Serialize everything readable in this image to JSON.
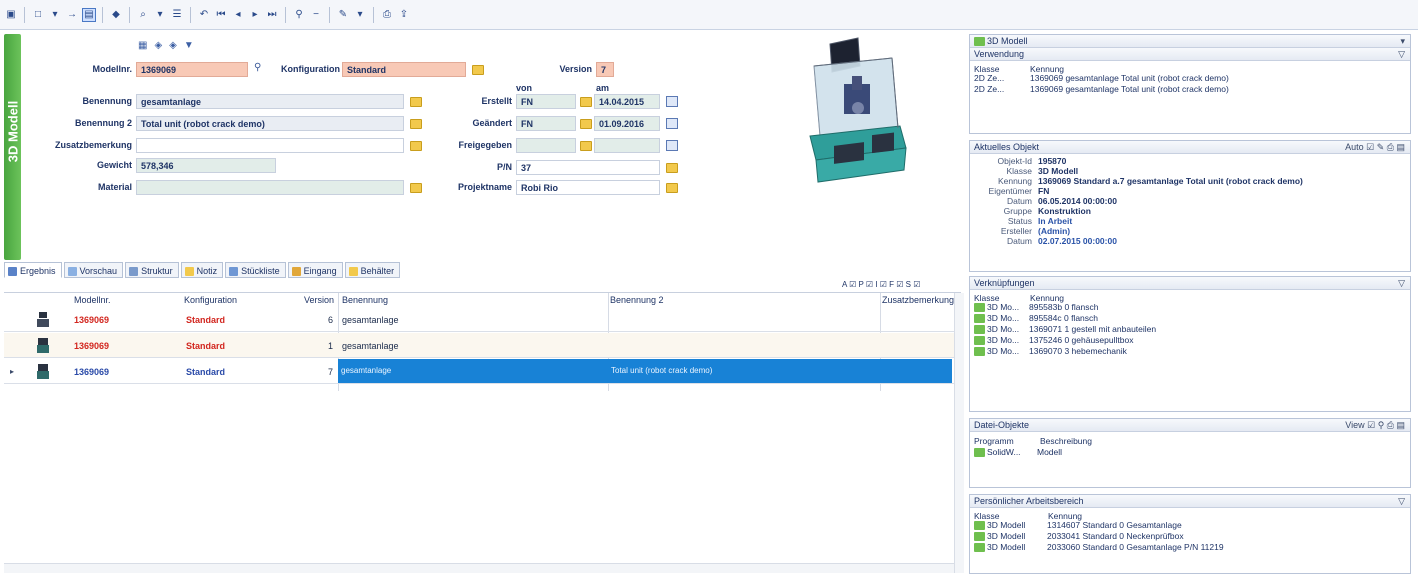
{
  "form": {
    "modellnr_label": "Modellnr.",
    "modellnr_value": "1369069",
    "konfiguration_label": "Konfiguration",
    "konfiguration_value": "Standard",
    "version_label": "Version",
    "version_value": "7",
    "von_label": "von",
    "am_label": "am",
    "benennung_label": "Benennung",
    "benennung_value": "gesamtanlage",
    "benennung2_label": "Benennung 2",
    "benennung2_value": "Total unit (robot crack demo)",
    "zusatz_label": "Zusatzbemerkung",
    "gewicht_label": "Gewicht",
    "gewicht_value": "578,346",
    "material_label": "Material",
    "erstellt_label": "Erstellt",
    "erstellt_von": "FN",
    "erstellt_am": "14.04.2015",
    "geaendert_label": "Geändert",
    "geaendert_von": "FN",
    "geaendert_am": "01.09.2016",
    "freigegeben_label": "Freigegeben",
    "pn_label": "P/N",
    "pn_value": "37",
    "projektname_label": "Projektname",
    "projektname_value": "Robi Rio",
    "band_label": "3D Modell"
  },
  "tabs": [
    "Ergebnis",
    "Vorschau",
    "Struktur",
    "Notiz",
    "Stückliste",
    "Eingang",
    "Behälter"
  ],
  "filters": "A ☑ P ☑ I ☑ F ☑ S ☑",
  "grid": {
    "columns": [
      "Modellnr.",
      "Konfiguration",
      "Version",
      "Benennung",
      "Benennung 2",
      "Zusatzbemerkung"
    ],
    "rows": [
      {
        "modellnr": "1369069",
        "konfig": "Standard",
        "version": "6",
        "benennung": "gesamtanlage",
        "benennung2": ""
      },
      {
        "modellnr": "1369069",
        "konfig": "Standard",
        "version": "1",
        "benennung": "gesamtanlage",
        "benennung2": ""
      },
      {
        "modellnr": "1369069",
        "konfig": "Standard",
        "version": "7",
        "benennung": "gesamtanlage",
        "benennung2": "Total unit (robot crack demo)"
      }
    ]
  },
  "panel_verwendung": {
    "selector": "3D Modell",
    "title": "Verwendung",
    "col_klasse": "Klasse",
    "col_kennung": "Kennung",
    "rows": [
      {
        "klasse": "2D Ze...",
        "kennung": "1369069 gesamtanlage Total unit (robot crack demo)"
      },
      {
        "klasse": "2D Ze...",
        "kennung": "1369069 gesamtanlage Total unit (robot crack demo)"
      }
    ]
  },
  "panel_aktuell": {
    "title": "Aktuelles Objekt",
    "right": "Auto ☑",
    "rows": [
      {
        "k": "Objekt-Id",
        "v": "195870"
      },
      {
        "k": "Klasse",
        "v": "3D Modell"
      },
      {
        "k": "Kennung",
        "v": "1369069 Standard a.7 gesamtanlage Total unit (robot crack demo)"
      },
      {
        "k": "Eigentümer",
        "v": "FN"
      },
      {
        "k": "Datum",
        "v": "06.05.2014 00:00:00"
      },
      {
        "k": "Gruppe",
        "v": "Konstruktion"
      },
      {
        "k": "Status",
        "v": "In Arbeit"
      },
      {
        "k": "Ersteller",
        "v": "(Admin)"
      },
      {
        "k": "Datum",
        "v": "02.07.2015 00:00:00"
      }
    ]
  },
  "panel_verknuepfungen": {
    "title": "Verknüpfungen",
    "col_klasse": "Klasse",
    "col_kennung": "Kennung",
    "rows": [
      {
        "klasse": "3D Mo...",
        "kennung": "895583b 0 flansch"
      },
      {
        "klasse": "3D Mo...",
        "kennung": "895584c 0 flansch"
      },
      {
        "klasse": "3D Mo...",
        "kennung": "1369071 1 gestell mit anbauteilen"
      },
      {
        "klasse": "3D Mo...",
        "kennung": "1375246 0 gehäusepulltbox"
      },
      {
        "klasse": "3D Mo...",
        "kennung": "1369070 3 hebemechanik"
      }
    ]
  },
  "panel_datei": {
    "title": "Datei-Objekte",
    "right": "View ☑",
    "col_programm": "Programm",
    "col_beschreibung": "Beschreibung",
    "rows": [
      {
        "programm": "SolidW...",
        "beschreibung": "Modell"
      }
    ]
  },
  "panel_persoenlich": {
    "title": "Persönlicher Arbeitsbereich",
    "col_klasse": "Klasse",
    "col_kennung": "Kennung",
    "rows": [
      {
        "klasse": "3D Modell",
        "kennung": "1314607 Standard 0 Gesamtanlage"
      },
      {
        "klasse": "3D Modell",
        "kennung": "2033041 Standard 0 Neckenprüfbox"
      },
      {
        "klasse": "3D Modell",
        "kennung": "2033060 Standard 0 Gesamtanlage P/N 11219"
      }
    ]
  },
  "colors": {
    "accent": "#1882d6",
    "pink_field": "#f8c9b6",
    "band_green": "#5bb24c",
    "red_text": "#d2261f"
  }
}
